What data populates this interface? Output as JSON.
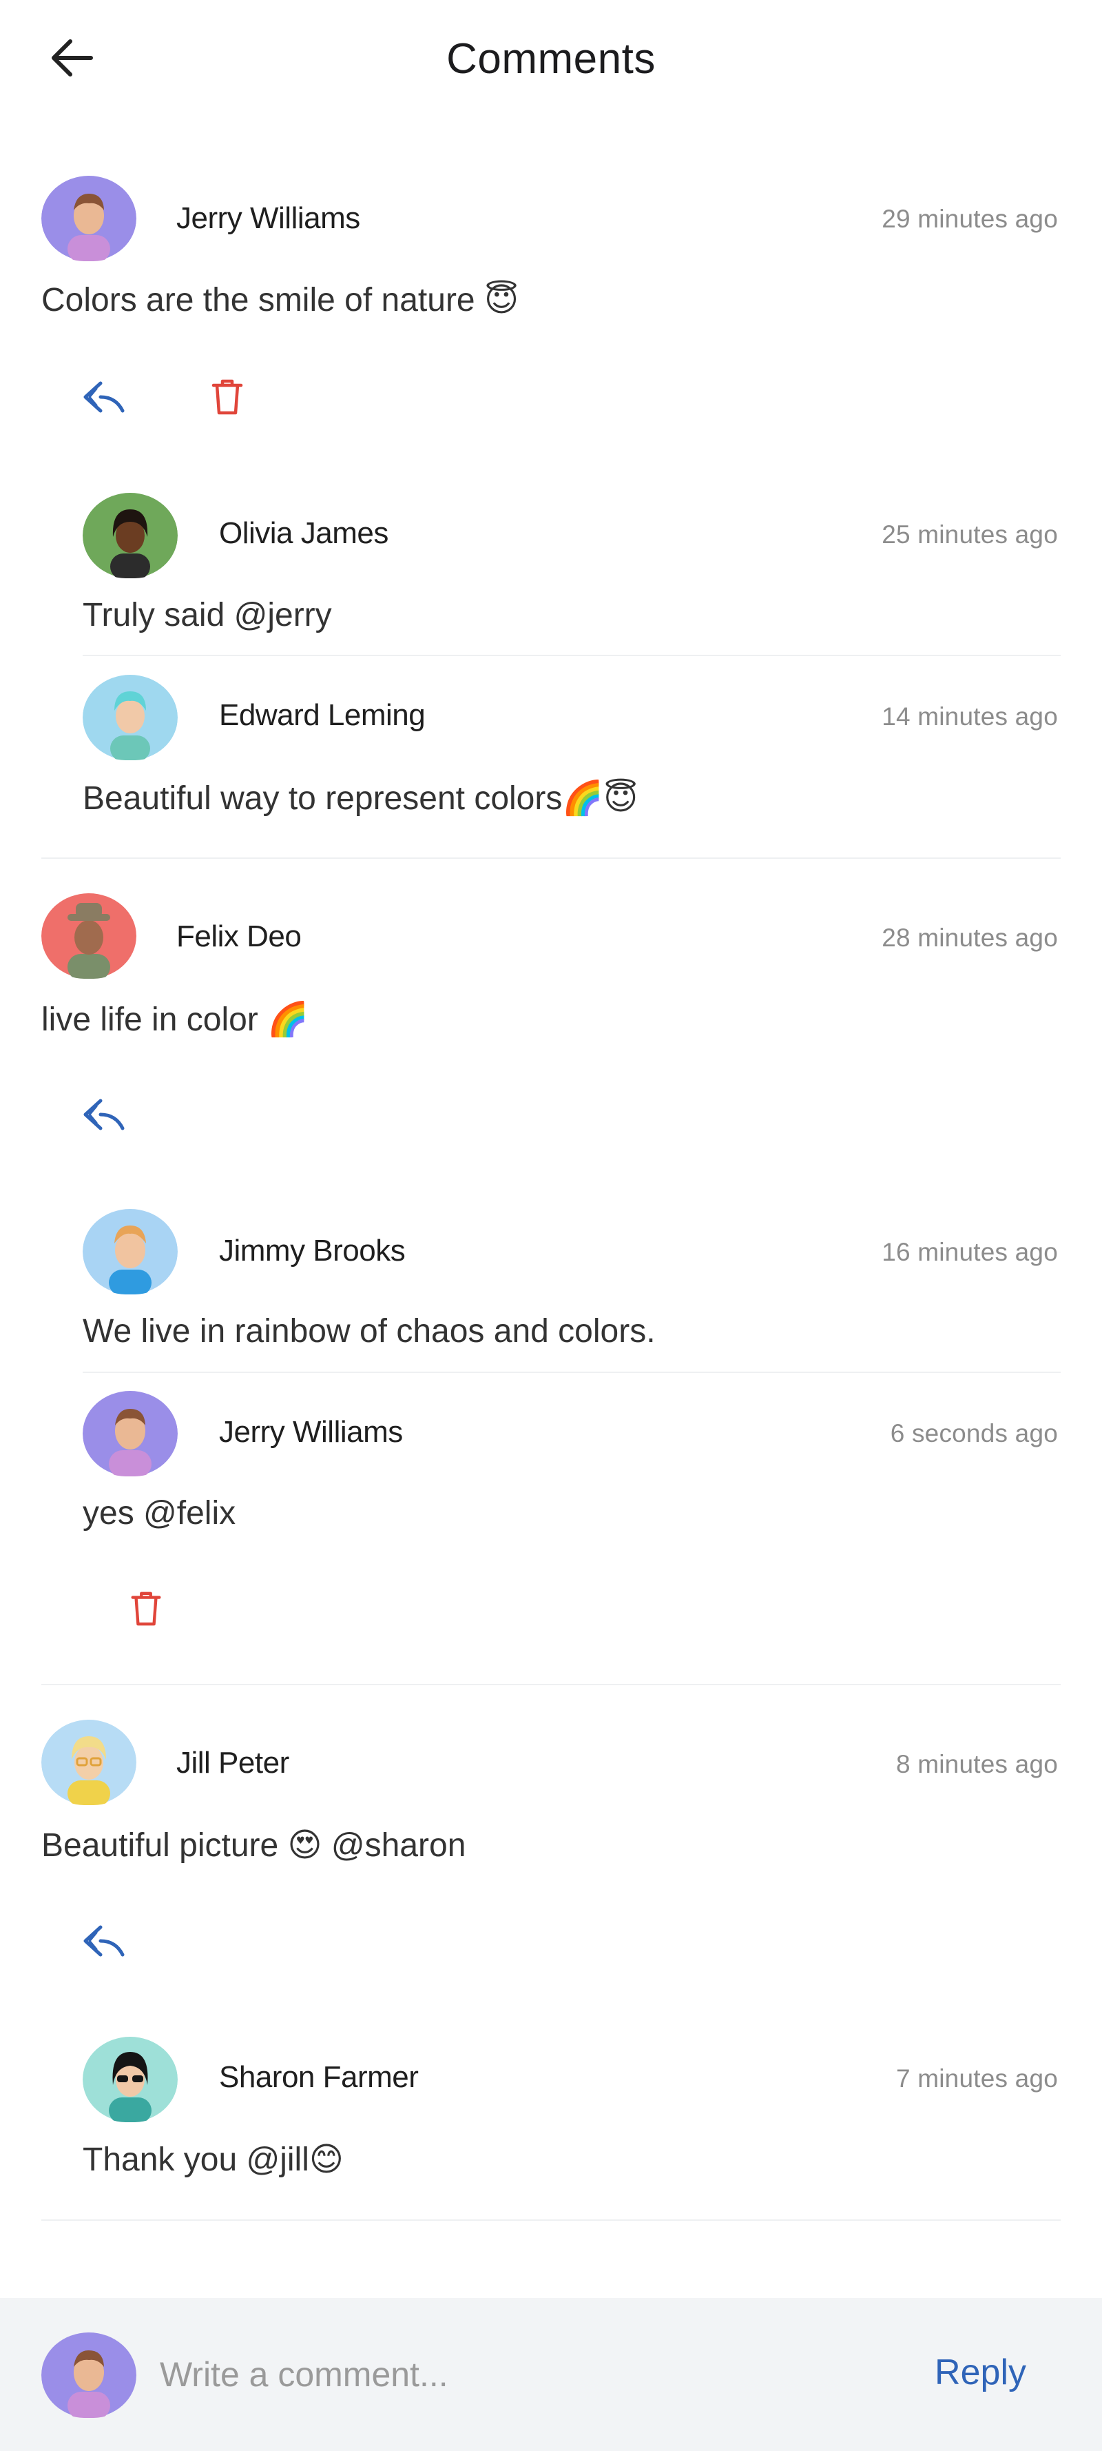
{
  "header": {
    "title": "Comments",
    "back_icon": "arrow-left-icon"
  },
  "comments": [
    {
      "author": "Jerry Williams",
      "time": "29 minutes ago",
      "text": "Colors are the smile of nature 😇",
      "actions": [
        "reply-icon",
        "trash-icon"
      ],
      "replies": [
        {
          "author": "Olivia James",
          "time": "25 minutes ago",
          "text": "Truly said @jerry"
        },
        {
          "author": "Edward Leming",
          "time": "14 minutes ago",
          "text": "Beautiful way to represent colors🌈😇"
        }
      ]
    },
    {
      "author": "Felix Deo",
      "time": "28 minutes ago",
      "text": "live life in color 🌈",
      "actions": [
        "reply-icon"
      ],
      "replies": [
        {
          "author": "Jimmy Brooks",
          "time": "16 minutes ago",
          "text": "We live in rainbow of chaos and colors."
        },
        {
          "author": "Jerry Williams",
          "time": "6 seconds ago",
          "text": "yes @felix",
          "actions": [
            "trash-icon"
          ]
        }
      ]
    },
    {
      "author": "Jill Peter",
      "time": "8 minutes ago",
      "text": "Beautiful picture 😍 @sharon",
      "actions": [
        "reply-icon"
      ],
      "replies": [
        {
          "author": "Sharon Farmer",
          "time": "7 minutes ago",
          "text": "Thank you @jill😊"
        }
      ]
    }
  ],
  "footer": {
    "placeholder": "Write a comment...",
    "reply_label": "Reply"
  },
  "colors": {
    "accent": "#2f64b8",
    "delete": "#e0453a",
    "timestamp": "#8c8c8c",
    "footer_bg": "#f2f4f6",
    "divider": "#eef0f2"
  }
}
